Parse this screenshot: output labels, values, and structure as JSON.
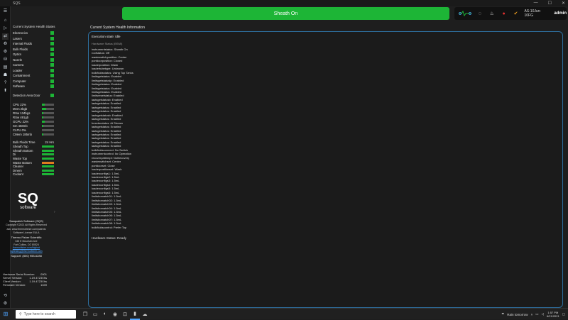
{
  "window": {
    "title": "SQS",
    "min": "—",
    "max": "☐",
    "close": "✕"
  },
  "rail": [
    "☰",
    "⌂",
    "▷",
    "⇄",
    "♻",
    "⚙",
    "⛁",
    "▤",
    "☗",
    "?",
    "⬆"
  ],
  "rail_bottom": [
    "⟲",
    "⚙"
  ],
  "banner": {
    "text": "Sheath On",
    "color": "#1db536"
  },
  "header": {
    "date": "AS-10Jun-10FG",
    "user": "admin"
  },
  "left": {
    "health_title": "Current System Health States",
    "systems": [
      "Electronics",
      "Lasers",
      "Internal Fluids",
      "Bulk Fluids",
      "Optics",
      "Nozzle",
      "Camera",
      "Loader",
      "Containment",
      "Computer",
      "Software"
    ],
    "detection_label": "Detection Area Door",
    "resources": [
      {
        "label": "CPU 22%",
        "fill": 0.22
      },
      {
        "label": "Mem 2bgb",
        "fill": 0.35
      },
      {
        "label": "RSw 134bgs",
        "fill": 0.1
      },
      {
        "label": "RSw 491gb",
        "fill": 0.1
      },
      {
        "label": "GCPU 22%",
        "fill": 0.22
      },
      {
        "label": "Sm 468mb",
        "fill": 0.1
      },
      {
        "label": "CLPU 0%",
        "fill": 0.0
      },
      {
        "label": "CMem 185mb",
        "fill": 0.1
      }
    ],
    "fluid_time_label": "Bulk Fluids Time",
    "fluid_time_value": "24 Hrs",
    "fluids": [
      {
        "label": "Sheath Top",
        "fill": 1.0,
        "color": "#1db536"
      },
      {
        "label": "Sheath Bottom",
        "fill": 1.0,
        "color": "#1db536"
      },
      {
        "label": "Di",
        "fill": 1.0,
        "color": "#1db536"
      },
      {
        "label": "Waste Top",
        "fill": 1.0,
        "color": "#1db536"
      },
      {
        "label": "Waste Bottom",
        "fill": 1.0,
        "color": "#e07b20"
      },
      {
        "label": "Cleaner",
        "fill": 1.0,
        "color": "#1db536"
      },
      {
        "label": "Dmem",
        "fill": 1.0,
        "color": "#1db536"
      },
      {
        "label": "Coolant",
        "fill": 1.0,
        "color": "#1db536"
      }
    ],
    "logo_main": "SQ",
    "logo_sub": "software",
    "company": "Sasquatch Software (SQS)",
    "copyright": "Copyright ©2021 All Rights Reserved",
    "license_line1": "ask: www.thermofisher.com/patents",
    "license_line2": "Software License EULA",
    "maker": "Thermo Fisher Scientific",
    "address1": "345 E Mountain Ave",
    "address2": "Fort Collins, CO 80524",
    "site": "thermofisher.com/bigfoot",
    "email": "sqltesting@thermofisher.com",
    "support": "Support: (800) 955-6288",
    "versions": [
      {
        "label": "Hardware Serial Number:",
        "value": "0001"
      },
      {
        "label": "Server Version:",
        "value": "1.19.4723Xhs"
      },
      {
        "label": "Client Version:",
        "value": "1.19.4723Xhs"
      },
      {
        "label": "Firmware Version:",
        "value": "1049"
      }
    ]
  },
  "main": {
    "title": "Current System Health Information",
    "exec_state": "Execution state: Idle",
    "hw_label": "Hardware Status (BSMI)",
    "lines": [
      "instrumentstatus: Sheath On",
      "roofstatus: Off",
      "wasteswitchposition: Center",
      "portdoorposition: Closed",
      "loaderposition: Wash",
      "loadertubetype: Unknown",
      "bulkfluidsstatus: Using Top Tanks",
      "limitsgetstatus: Enabled",
      "limitsgetstatusip: Enabled",
      "limitsgetstatus: Enabled",
      "limitsgetstatus: Enabled",
      "limitsgetstatus: Enabled",
      "limitsresetstatus: Enabled",
      "lastsgetstatusb: Enabled",
      "lastsgetstatus: Enabled",
      "lastsgetstatus: Enabled",
      "lastsgetstatus: Enabled",
      "lastsgetstatusb: Enabled",
      "lastsgetstatus: Enabled",
      "fcreeterstatus: At Stream",
      "lastsgetstatus: Enabled",
      "lastsgetstatus: Enabled",
      "lastsgetstatus: Enabled",
      "lastsgetstatus: Enabled",
      "lastsgetstatus: Enabled",
      "lastsgetstatus: Enabled",
      "bulkfluidsconnect: No Switch",
      "instrumentcontrol: Ito Operation",
      "recoveryattempt: Nollrecovery",
      "wasteswitchset: Center",
      "portdoorset: Close",
      "loaderpositionset: Wash",
      "loaderconfigs1: 1.5mL",
      "loaderconfigs2: 1.5mL",
      "loaderconfigs3: 1.5mL",
      "loaderconfigs4: 1.5mL",
      "loaderconfigs5: 1.5mL",
      "loaderconfigs6: 1.5mL",
      "limitsbomatch01: 1.5mL",
      "limitsbomatch02: 1.5mL",
      "limitsbomatch03: 1.5mL",
      "limitsbomatch04: 1.5mL",
      "limitsbomatch05: 1.5mL",
      "limitsbomatch06: 1.5mL",
      "limitsbomatch07: 1.5mL",
      "limitsbomatch08: 1.5mL",
      "bulkfluidscontrol: Prefer Top"
    ],
    "hw_status": "Hardware Status:  Ready"
  },
  "taskbar": {
    "search_placeholder": "Type here to search",
    "weather": "Rain tomorrow",
    "time": "1:57 PM",
    "date": "6/21/2021"
  }
}
